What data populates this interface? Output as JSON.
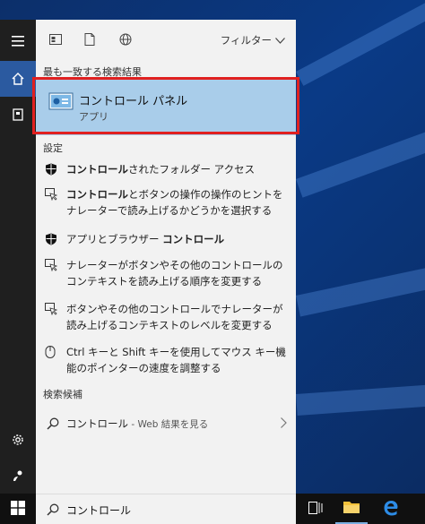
{
  "filters": {
    "label": "フィルター"
  },
  "best_match": {
    "header": "最も一致する検索結果",
    "title": "コントロール パネル",
    "subtitle": "アプリ"
  },
  "settings": {
    "header": "設定",
    "items": [
      {
        "icon": "shield-icon",
        "bold": "コントロール",
        "rest": "されたフォルダー アクセス"
      },
      {
        "icon": "narrator-icon",
        "bold": "コントロール",
        "rest": "とボタンの操作の操作のヒントをナレーターで読み上げるかどうかを選択する"
      },
      {
        "icon": "shield-icon",
        "prefix": "アプリとブラウザー ",
        "bold": "コントロール",
        "rest": ""
      },
      {
        "icon": "narrator-icon",
        "text": "ナレーターがボタンやその他のコントロールのコンテキストを読み上げる順序を変更する"
      },
      {
        "icon": "narrator-icon",
        "text": "ボタンやその他のコントロールでナレーターが読み上げるコンテキストのレベルを変更する"
      },
      {
        "icon": "mouse-icon",
        "text": "Ctrl キーと Shift キーを使用してマウス キー機能のポインターの速度を調整する"
      }
    ]
  },
  "suggestions": {
    "header": "検索候補",
    "item": {
      "text": "コントロール",
      "hint": " - Web 結果を見る"
    }
  },
  "search": {
    "value": "コントロール"
  }
}
